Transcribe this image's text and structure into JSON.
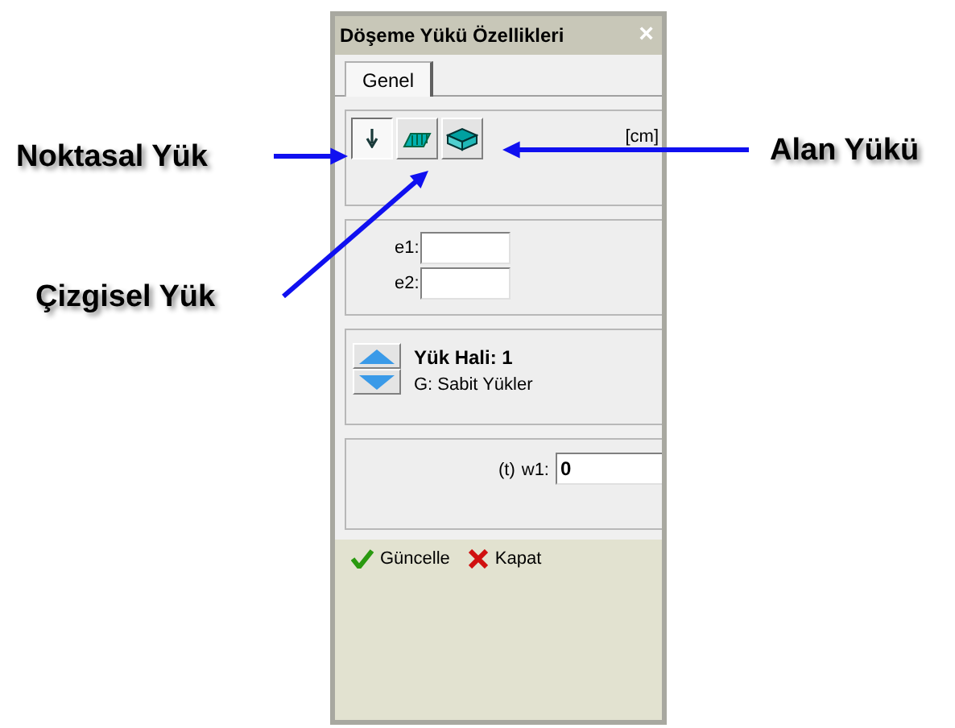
{
  "window": {
    "title": "Döşeme Yükü Özellikleri",
    "close": "×"
  },
  "tabs": [
    {
      "label": "Genel",
      "selected": true
    }
  ],
  "load_types": [
    {
      "kind": "point",
      "selected": true
    },
    {
      "kind": "line",
      "selected": false
    },
    {
      "kind": "area",
      "selected": false
    }
  ],
  "unit": "[cm]",
  "fields": [
    {
      "label": "e1:"
    },
    {
      "label": "e2:"
    }
  ],
  "load_case": {
    "title": "Yük Hali: 1",
    "name": "G: Sabit Yükler"
  },
  "w1": {
    "unit": "(t)",
    "label": "w1:",
    "value": "0"
  },
  "buttons": [
    {
      "kind": "update",
      "label": "Güncelle"
    },
    {
      "kind": "close",
      "label": "Kapat"
    }
  ],
  "annotations": [
    {
      "label": "Noktasal Yük"
    },
    {
      "label": "Çizgisel Yük"
    },
    {
      "label": "Alan Yükü"
    }
  ]
}
